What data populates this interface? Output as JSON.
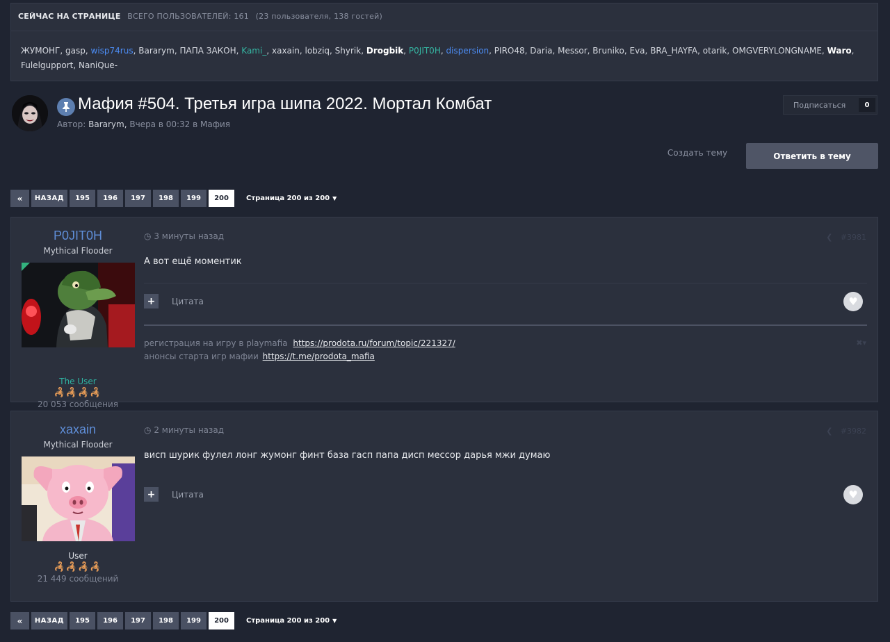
{
  "online": {
    "heading": "Сейчас на странице",
    "total": "Всего пользователей: 161",
    "breakdown": "(23 пользователя, 138 гостей)",
    "users": [
      {
        "name": "ЖУМОНГ",
        "style": "plain"
      },
      {
        "name": "gasp",
        "style": "plain"
      },
      {
        "name": "wisp74rus",
        "style": "blue"
      },
      {
        "name": "Bararym",
        "style": "plain"
      },
      {
        "name": "ПАПА ЗАКОН",
        "style": "plain"
      },
      {
        "name": "Kami_",
        "style": "teal"
      },
      {
        "name": "xaxain",
        "style": "plain"
      },
      {
        "name": "lobziq",
        "style": "plain"
      },
      {
        "name": "Shyrik",
        "style": "plain"
      },
      {
        "name": "Drogbik",
        "style": "bold"
      },
      {
        "name": "P0JIT0H",
        "style": "teal"
      },
      {
        "name": "dispersion",
        "style": "blue"
      },
      {
        "name": "PIRO48",
        "style": "plain"
      },
      {
        "name": "Daria",
        "style": "plain"
      },
      {
        "name": "Messor",
        "style": "plain"
      },
      {
        "name": "Bruniko",
        "style": "plain"
      },
      {
        "name": "Eva",
        "style": "plain"
      },
      {
        "name": "BRA_HAYFA",
        "style": "plain"
      },
      {
        "name": "otarik",
        "style": "plain"
      },
      {
        "name": "OMGVERYLONGNAME",
        "style": "plain"
      },
      {
        "name": "Waro",
        "style": "bold"
      },
      {
        "name": "Fulelgupport",
        "style": "plain"
      },
      {
        "name": "NaniQue-",
        "style": "plain"
      }
    ]
  },
  "topic": {
    "title": "Мафия #504. Третья игра шипа 2022. Мортал Комбат",
    "author_prefix": "Автор:",
    "author": "Bararym,",
    "when": "Вчера в 00:32 в Мафия",
    "subscribe_label": "Подписаться",
    "subscribe_count": "0",
    "create_topic": "Создать тему",
    "reply": "Ответить в тему"
  },
  "pagination": {
    "first": "«",
    "back": "НАЗАД",
    "pages": [
      "195",
      "196",
      "197",
      "198",
      "199",
      "200"
    ],
    "active": "200",
    "info": "Страница 200 из 200"
  },
  "icons": {
    "pin": "pin-icon",
    "clock": "clock-icon",
    "share": "share-icon",
    "heart": "heart-icon",
    "plus": "plus-icon",
    "caret": "caret-down-icon"
  },
  "posts": [
    {
      "author": "P0JIT0H",
      "rank": "Mythical Flooder",
      "group": "The User",
      "badges": "🦂🦂🦂🦂",
      "post_count": "20 053 сообщения",
      "time": "3 минуты назад",
      "number": "#3981",
      "body": "А вот ещё моментик",
      "quote": "Цитата",
      "signature": {
        "line1_text": "регистрация на игру в playmafia",
        "line1_link": "https://prodota.ru/forum/topic/221327/",
        "line2_text": "анонсы старта игр мафии",
        "line2_link": "https://t.me/prodota_mafia"
      }
    },
    {
      "author": "xaxain",
      "rank": "Mythical Flooder",
      "group": "User",
      "badges": "🦂🦂🦂🦂",
      "post_count": "21 449 сообщений",
      "time": "2 минуты назад",
      "number": "#3982",
      "body": "висп шурик фулел лонг жумонг финт база гасп папа дисп мессор дарья мжи думаю",
      "quote": "Цитата"
    }
  ],
  "colors": {
    "background": "#1f2431",
    "panel": "#2b303d",
    "accent_blue": "#4c8df5",
    "accent_teal": "#35b5a2",
    "reply_button": "#4f5566"
  }
}
